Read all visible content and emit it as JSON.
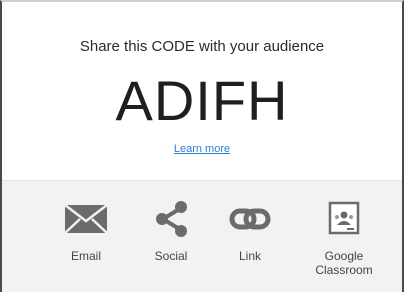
{
  "share": {
    "headline": "Share this CODE with your audience",
    "code": "ADIFH",
    "learn_more": "Learn more"
  },
  "options": [
    {
      "label": "Email",
      "icon": "envelope-icon"
    },
    {
      "label": "Social",
      "icon": "share-icon"
    },
    {
      "label": "Link",
      "icon": "link-icon"
    },
    {
      "label": "Google Classroom",
      "icon": "google-classroom-icon"
    }
  ],
  "colors": {
    "link": "#2f7fd6",
    "icon": "#6b6b6b",
    "footer_bg": "#f2f2f2"
  }
}
